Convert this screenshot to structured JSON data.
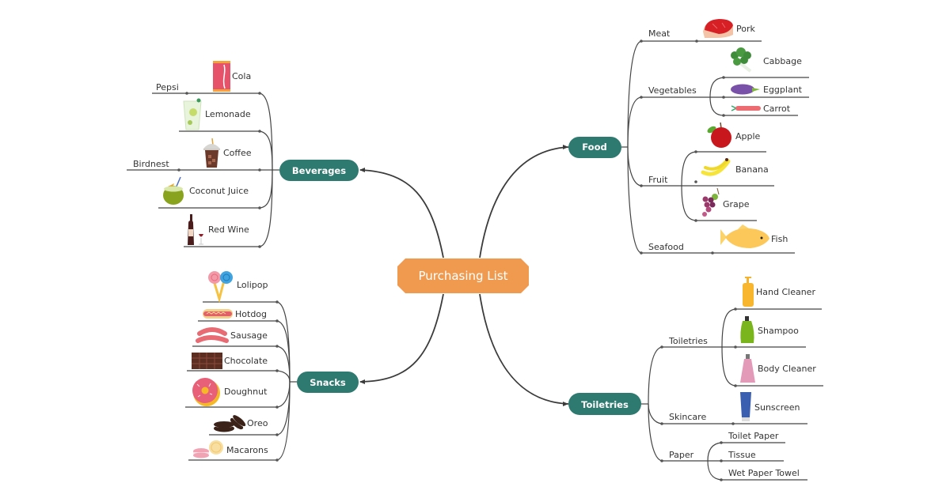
{
  "root": {
    "label": "Purchasing List",
    "color": "#f09a50"
  },
  "topic_color": "#2e7a70",
  "topics": {
    "beverages": {
      "label": "Beverages",
      "items": [
        {
          "label": "Cola",
          "icon": "soda-can-icon"
        },
        {
          "label": "Pepsi",
          "icon": null
        },
        {
          "label": "Lemonade",
          "icon": "lemonade-glass-icon"
        },
        {
          "label": "Coffee",
          "icon": "iced-coffee-icon"
        },
        {
          "label": "Birdnest",
          "icon": null
        },
        {
          "label": "Coconut Juice",
          "icon": "coconut-drink-icon"
        },
        {
          "label": "Red Wine",
          "icon": "wine-bottle-icon"
        }
      ]
    },
    "snacks": {
      "label": "Snacks",
      "items": [
        {
          "label": "Lolipop",
          "icon": "lollipop-icon"
        },
        {
          "label": "Hotdog",
          "icon": "hotdog-icon"
        },
        {
          "label": "Sausage",
          "icon": "sausage-icon"
        },
        {
          "label": "Chocolate",
          "icon": "chocolate-bar-icon"
        },
        {
          "label": "Doughnut",
          "icon": "doughnut-icon"
        },
        {
          "label": "Oreo",
          "icon": "oreo-cookie-icon"
        },
        {
          "label": "Macarons",
          "icon": "macaron-icon"
        }
      ]
    },
    "food": {
      "label": "Food",
      "groups": [
        {
          "label": "Meat",
          "items": [
            {
              "label": "Pork",
              "icon": "steak-icon"
            }
          ]
        },
        {
          "label": "Vegetables",
          "items": [
            {
              "label": "Cabbage",
              "icon": "broccoli-icon"
            },
            {
              "label": "Eggplant",
              "icon": "eggplant-icon"
            },
            {
              "label": "Carrot",
              "icon": "carrot-icon"
            }
          ]
        },
        {
          "label": "Fruit",
          "items": [
            {
              "label": "Apple",
              "icon": "apple-icon"
            },
            {
              "label": "Banana",
              "icon": "banana-icon"
            },
            {
              "label": "Grape",
              "icon": "grape-icon"
            }
          ]
        },
        {
          "label": "Seafood",
          "items": [
            {
              "label": "Fish",
              "icon": "fish-icon"
            }
          ]
        }
      ]
    },
    "toiletries": {
      "label": "Toiletries",
      "groups": [
        {
          "label": "Toiletries",
          "items": [
            {
              "label": "Hand Cleaner",
              "icon": "pump-bottle-orange-icon"
            },
            {
              "label": "Shampoo",
              "icon": "shampoo-bottle-icon"
            },
            {
              "label": "Body Cleaner",
              "icon": "pump-bottle-pink-icon"
            }
          ]
        },
        {
          "label": "Skincare",
          "items": [
            {
              "label": "Sunscreen",
              "icon": "sunscreen-tube-icon"
            }
          ]
        },
        {
          "label": "Paper",
          "items": [
            {
              "label": "Toilet Paper",
              "icon": null
            },
            {
              "label": "Tissue",
              "icon": null
            },
            {
              "label": "Wet Paper Towel",
              "icon": null
            }
          ]
        }
      ]
    }
  }
}
